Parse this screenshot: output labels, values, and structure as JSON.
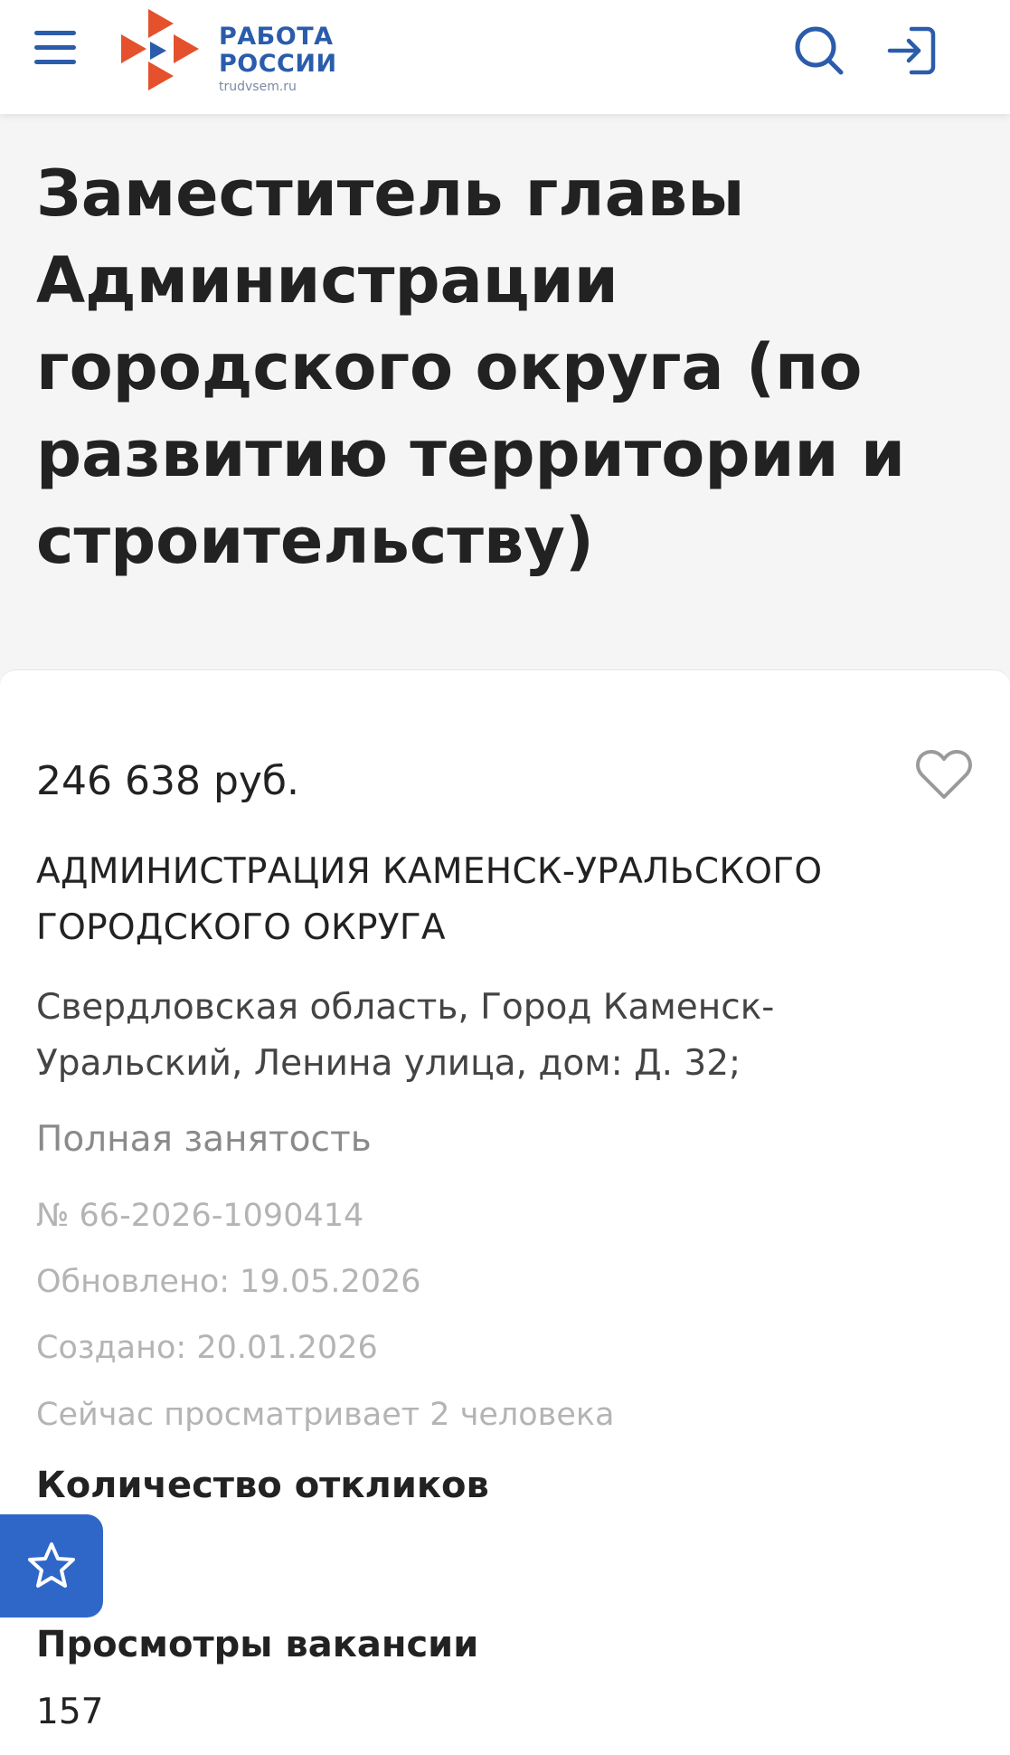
{
  "header": {
    "logo_line1": "РАБОТА",
    "logo_line2": "РОССИИ",
    "logo_sub": "trudvsem.ru",
    "icons": {
      "menu": "hamburger-icon",
      "search": "search-icon",
      "login": "login-icon"
    },
    "brand_color": "#2b5cab",
    "logo_accent_color": "#e4512c"
  },
  "vacancy": {
    "title": "Заместитель главы Администрации городского округа (по развитию территории и строительству)",
    "salary": "246 638 руб.",
    "employer": "АДМИНИСТРАЦИЯ КАМЕНСК-УРАЛЬСКОГО ГОРОДСКОГО ОКРУГА",
    "address": "Свердловская область, Город Каменск-Уральский, Ленина улица, дом: Д. 32;",
    "employment": "Полная занятость",
    "number": "№ 66-2026-1090414",
    "updated": "Обновлено: 19.05.2026",
    "created": "Создано: 20.01.2026",
    "viewing_now": "Сейчас просматривает 2 человека",
    "responses_label": "Количество откликов",
    "views_label": "Просмотры вакансии",
    "views_count": "157"
  },
  "actions": {
    "favorite_icon": "heart-icon",
    "floating_icon": "star-icon",
    "floating_color": "#2f67c8"
  }
}
